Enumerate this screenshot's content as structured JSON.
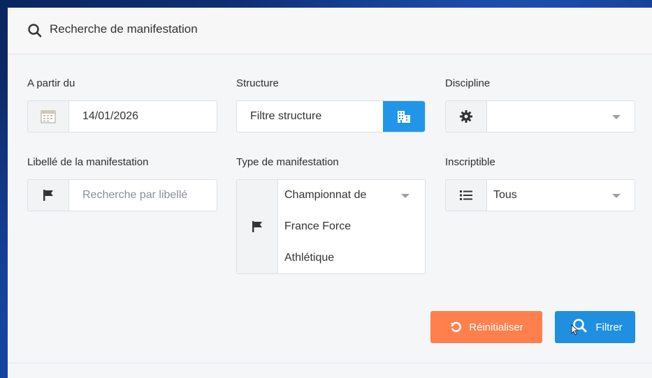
{
  "panel": {
    "title": "Recherche de manifestation"
  },
  "fields": {
    "date": {
      "label": "A partir du",
      "value": "14/01/2026"
    },
    "structure": {
      "label": "Structure",
      "value": "Filtre structure"
    },
    "discipline": {
      "label": "Discipline",
      "value": ""
    },
    "libelle": {
      "label": "Libellé de la manifestation",
      "placeholder": "Recherche par libellé"
    },
    "type": {
      "label": "Type de manifestation",
      "lines": [
        "Championnat de",
        "France Force",
        "Athlétique"
      ]
    },
    "inscriptible": {
      "label": "Inscriptible",
      "value": "Tous"
    }
  },
  "buttons": {
    "reset": "Réinitialiser",
    "filter": "Filtrer"
  },
  "colors": {
    "reset": "#ff7f4d",
    "filter": "#1f8fe0",
    "structure_addon": "#2196e9"
  },
  "icons": [
    "search-icon",
    "calendar-icon",
    "building-icon",
    "gear-icon",
    "flag-icon",
    "list-icon",
    "caret-down-icon",
    "undo-icon",
    "user-search-icon",
    "hand-cursor-icon"
  ]
}
